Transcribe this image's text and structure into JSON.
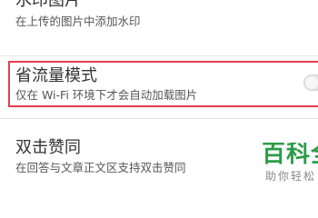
{
  "settings": {
    "items": [
      {
        "title": "水印图片",
        "description": "在上传的图片中添加水印"
      },
      {
        "title": "省流量模式",
        "description": "仅在 Wi-Fi 环境下才会自动加载图片",
        "toggle_on": false
      },
      {
        "title": "双击赞同",
        "description": "在回答与文章正文区支持双击赞同"
      }
    ]
  },
  "colors": {
    "highlight_border": "#e0404a",
    "watermark_green": "#2a9d46"
  },
  "watermark": {
    "main_text": "百科全",
    "sub_text": "助你轻松"
  }
}
